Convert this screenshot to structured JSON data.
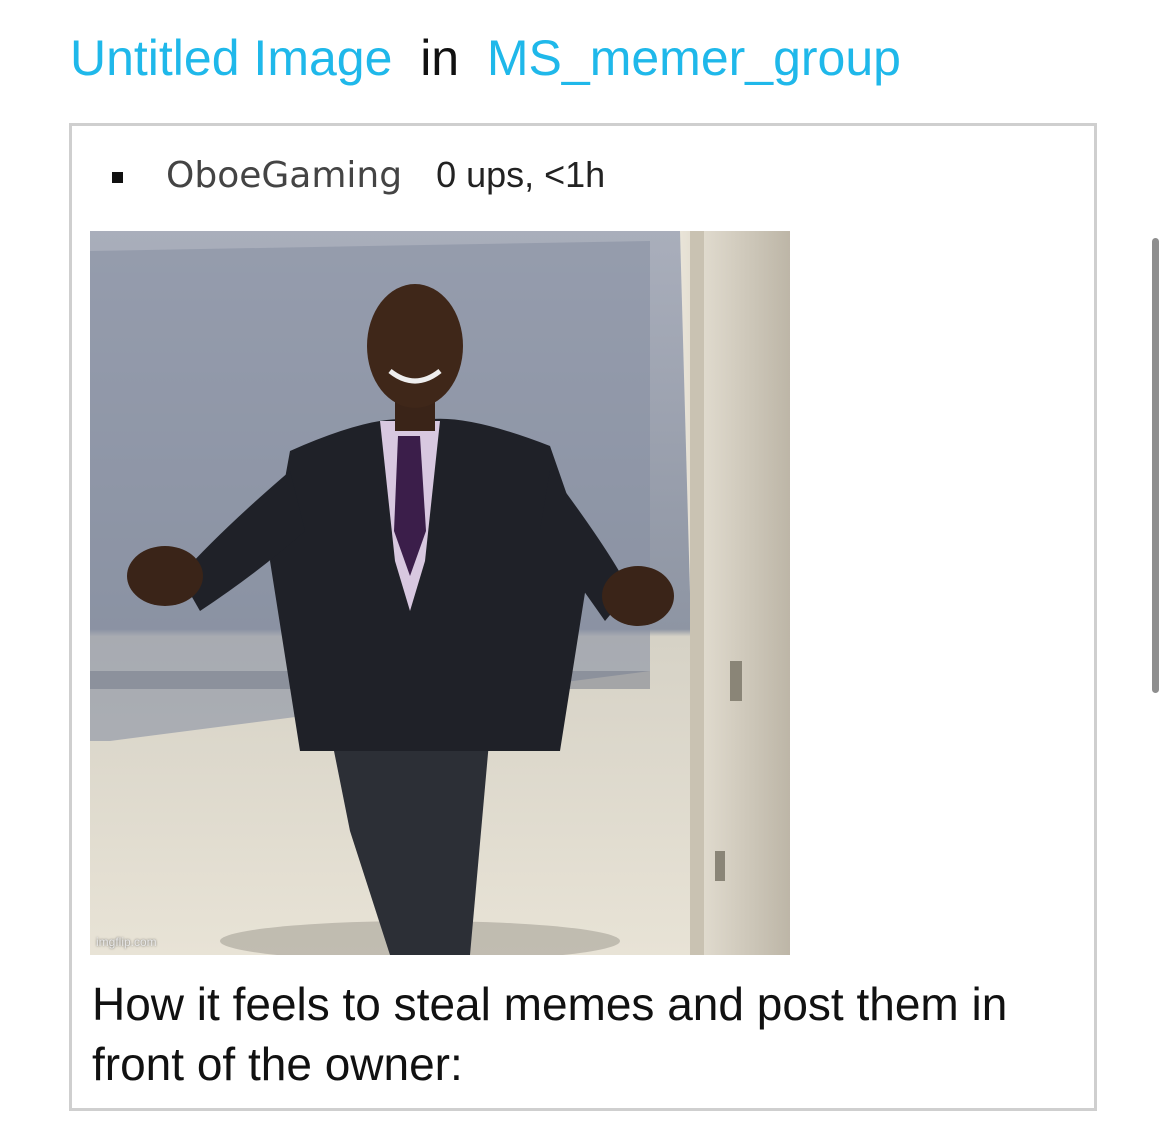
{
  "header": {
    "image_title": "Untitled Image",
    "connector": "in",
    "group_name": "MS_memer_group"
  },
  "post": {
    "username": "OboeGaming",
    "stats": "0 ups, <1h",
    "image": {
      "description_icon": "meme-photo",
      "watermark": "imgflip.com"
    },
    "caption": "How it feels to steal memes and post them in front of the owner:"
  },
  "colors": {
    "link": "#1fb8ea",
    "card_border": "#cfcfcf",
    "text": "#111111"
  }
}
